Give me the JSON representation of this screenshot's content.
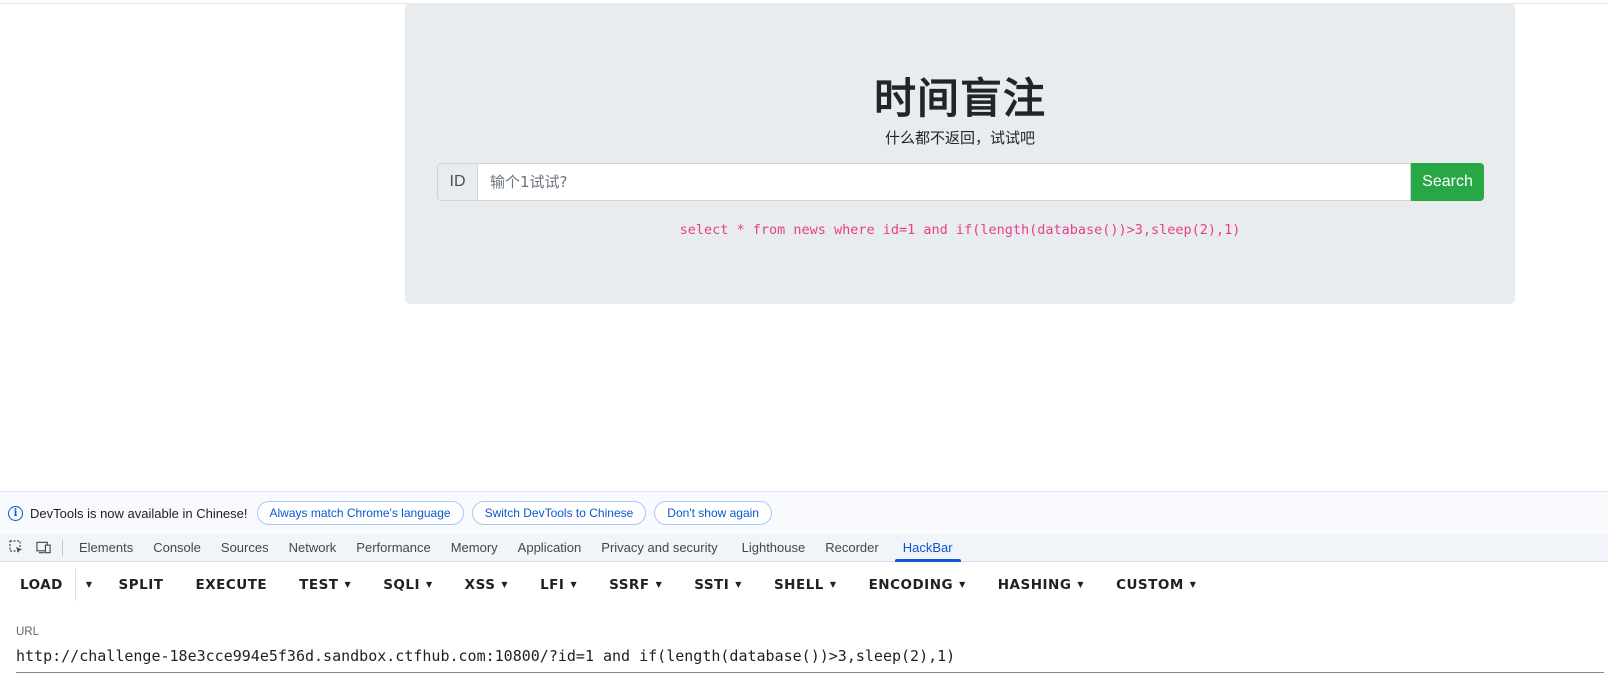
{
  "page": {
    "title": "时间盲注",
    "subtitle": "什么都不返回，试试吧",
    "input_prefix": "ID",
    "input_placeholder": "输个1试试?",
    "search_label": "Search",
    "sql_query": "select * from news where id=1 and if(length(database())>3,sleep(2),1)"
  },
  "devtools": {
    "notice": {
      "text": "DevTools is now available in Chinese!",
      "buttons": [
        "Always match Chrome's language",
        "Switch DevTools to Chinese",
        "Don't show again"
      ]
    },
    "tabs": [
      "Elements",
      "Console",
      "Sources",
      "Network",
      "Performance",
      "Memory",
      "Application",
      "Privacy and security",
      "Lighthouse",
      "Recorder",
      "HackBar"
    ],
    "active_tab": "HackBar"
  },
  "hackbar": {
    "load": "LOAD",
    "menu": [
      "SPLIT",
      "EXECUTE",
      "TEST",
      "SQLI",
      "XSS",
      "LFI",
      "SSRF",
      "SSTI",
      "SHELL",
      "ENCODING",
      "HASHING",
      "CUSTOM"
    ],
    "url_label": "URL",
    "url_value": "http://challenge-18e3cce994e5f36d.sandbox.ctfhub.com:10800/?id=1 and if(length(database())>3,sleep(2),1)"
  },
  "colors": {
    "search_button": "#28a745",
    "sql_text": "#e83e8c",
    "devtools_accent": "#0b57d0"
  }
}
